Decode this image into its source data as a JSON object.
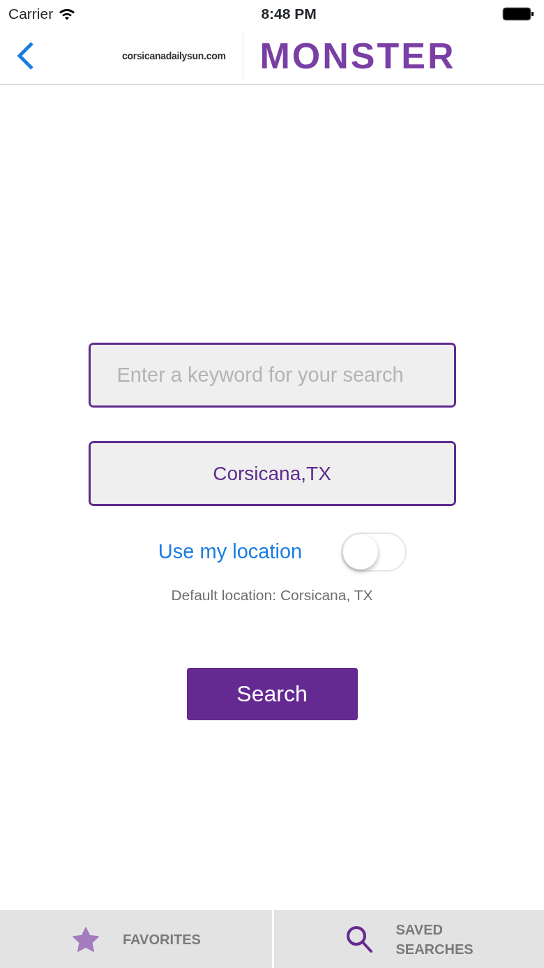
{
  "status_bar": {
    "carrier": "Carrier",
    "time": "8:48 PM"
  },
  "nav_bar": {
    "partner": "corsicanadailysun.com",
    "brand": "MONSTER"
  },
  "keyword_field": {
    "placeholder": "Enter a keyword for your search"
  },
  "location_field": {
    "value": "Corsicana,TX"
  },
  "location_toggle": {
    "label": "Use my location",
    "on": false
  },
  "default_location": "Default location: Corsicana, TX",
  "search_button": "Search",
  "tab_bar": [
    {
      "kind": "star",
      "label": "FAVORITES"
    },
    {
      "kind": "search",
      "label": "SAVED SEARCHES"
    }
  ]
}
